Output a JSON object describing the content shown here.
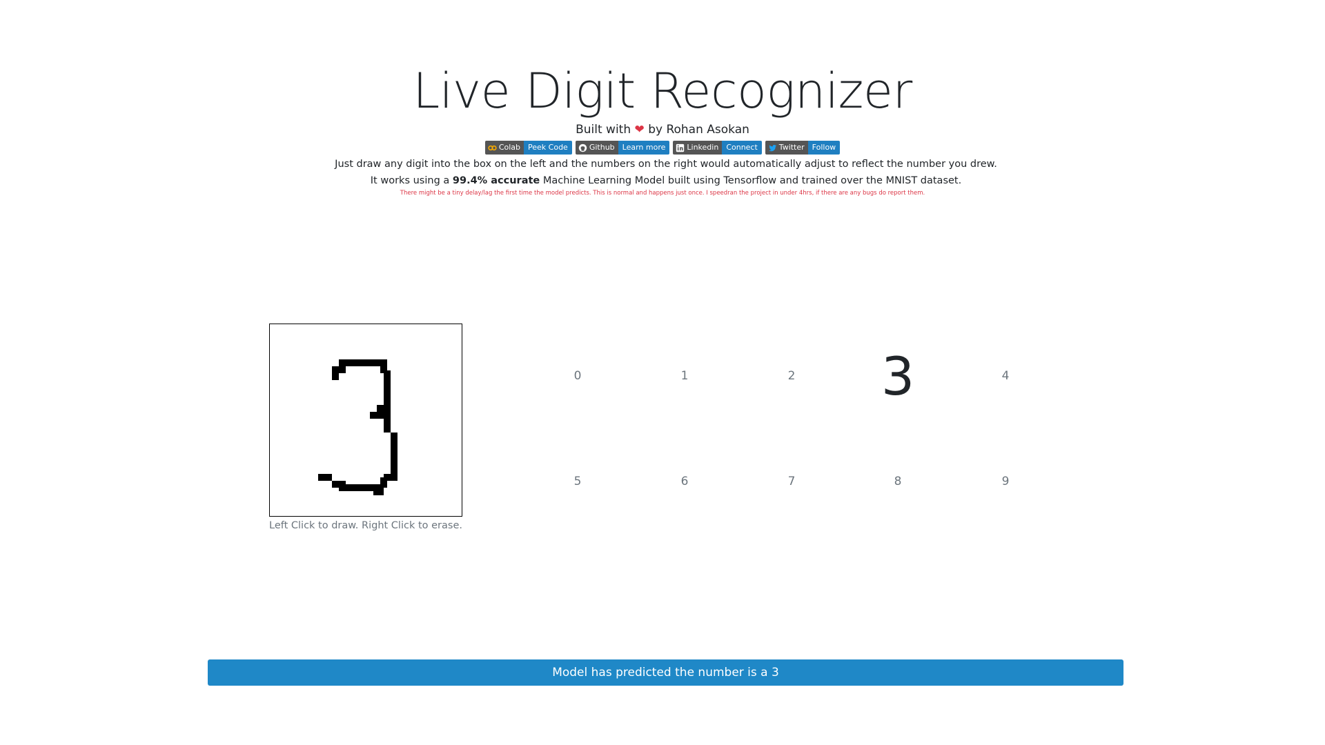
{
  "header": {
    "title": "Live Digit Recognizer",
    "byline_prefix": "Built with",
    "byline_suffix": "by Rohan Asokan",
    "heart_icon": "heart-icon"
  },
  "badges": [
    {
      "label": "Colab",
      "message": "Peek Code",
      "icon": "colab-icon"
    },
    {
      "label": "Github",
      "message": "Learn more",
      "icon": "github-icon"
    },
    {
      "label": "Linkedin",
      "message": "Connect",
      "icon": "linkedin-icon"
    },
    {
      "label": "Twitter",
      "message": "Follow",
      "icon": "twitter-icon"
    }
  ],
  "description": {
    "part1": "Just draw any digit into the box on the left and the numbers on the right would automatically adjust to reflect the number you drew. It works using a ",
    "bold": "99.4% accurate",
    "part2": " Machine Learning Model built using Tensorflow and trained over the MNIST dataset."
  },
  "note": "There might be a tiny delay/lag the first time the model predicts. This is normal and happens just once. I speedran the project in under 4hrs, if there are any bugs do report them.",
  "canvas": {
    "caption": "Left Click to draw. Right Click to erase."
  },
  "digits": [
    "0",
    "1",
    "2",
    "3",
    "4",
    "5",
    "6",
    "7",
    "8",
    "9"
  ],
  "prediction": {
    "digit": "3",
    "text": "Model has predicted the number is a 3"
  },
  "colors": {
    "accent": "#1f88c7",
    "badge_label": "#555555",
    "badge_message": "#1f7fc1",
    "heart": "#dc3545",
    "note": "#dc3545"
  }
}
